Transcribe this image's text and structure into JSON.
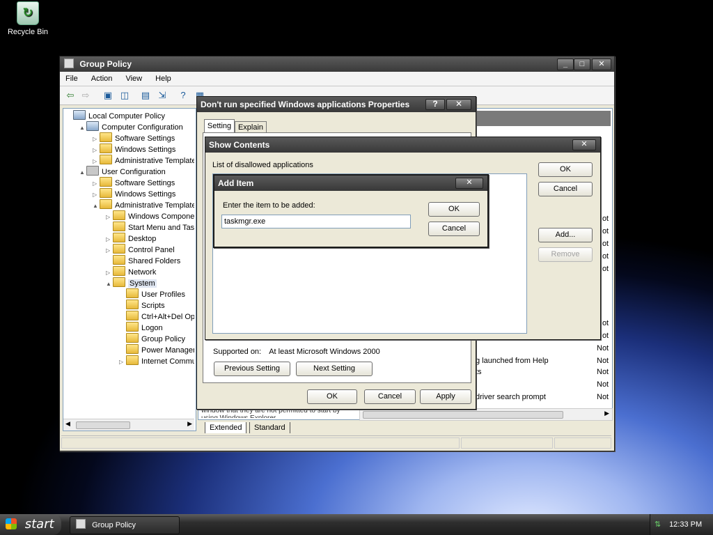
{
  "desktop": {
    "recycle_bin": "Recycle Bin"
  },
  "main_window": {
    "title": "Group Policy",
    "menu": [
      "File",
      "Action",
      "View",
      "Help"
    ],
    "tree": [
      {
        "label": "Local Computer Policy",
        "level": 0,
        "type": "computer"
      },
      {
        "label": "Computer Configuration",
        "level": 1,
        "type": "computer",
        "expander": "▲"
      },
      {
        "label": "Software Settings",
        "level": 2,
        "type": "folder",
        "expander": "▷"
      },
      {
        "label": "Windows Settings",
        "level": 2,
        "type": "folder",
        "expander": "▷"
      },
      {
        "label": "Administrative Templates",
        "level": 2,
        "type": "folder",
        "expander": "▷"
      },
      {
        "label": "User Configuration",
        "level": 1,
        "type": "user",
        "expander": "▲"
      },
      {
        "label": "Software Settings",
        "level": 2,
        "type": "folder",
        "expander": "▷"
      },
      {
        "label": "Windows Settings",
        "level": 2,
        "type": "folder",
        "expander": "▷"
      },
      {
        "label": "Administrative Templates",
        "level": 2,
        "type": "folder",
        "expander": "▲"
      },
      {
        "label": "Windows Components",
        "level": 3,
        "type": "folder",
        "expander": "▷"
      },
      {
        "label": "Start Menu and Taskbar",
        "level": 3,
        "type": "folder",
        "expander": ""
      },
      {
        "label": "Desktop",
        "level": 3,
        "type": "folder",
        "expander": "▷"
      },
      {
        "label": "Control Panel",
        "level": 3,
        "type": "folder",
        "expander": "▷"
      },
      {
        "label": "Shared Folders",
        "level": 3,
        "type": "folder",
        "expander": ""
      },
      {
        "label": "Network",
        "level": 3,
        "type": "folder",
        "expander": "▷"
      },
      {
        "label": "System",
        "level": 3,
        "type": "folder",
        "expander": "▲",
        "selected": true
      },
      {
        "label": "User Profiles",
        "level": 4,
        "type": "folder",
        "expander": ""
      },
      {
        "label": "Scripts",
        "level": 4,
        "type": "folder",
        "expander": ""
      },
      {
        "label": "Ctrl+Alt+Del Options",
        "level": 4,
        "type": "folder",
        "expander": ""
      },
      {
        "label": "Logon",
        "level": 4,
        "type": "folder",
        "expander": ""
      },
      {
        "label": "Group Policy",
        "level": 4,
        "type": "folder",
        "expander": ""
      },
      {
        "label": "Power Management",
        "level": 4,
        "type": "folder",
        "expander": ""
      },
      {
        "label": "Internet Communication",
        "level": 4,
        "type": "folder",
        "expander": "▷"
      }
    ],
    "right_list": [
      {
        "name": "",
        "state": "Not"
      },
      {
        "name": "",
        "state": "Not"
      },
      {
        "name": "",
        "state": "Not"
      },
      {
        "name": "",
        "state": "Not"
      },
      {
        "name": "",
        "state": "Not"
      },
      {
        "name": "",
        "state": "Not"
      },
      {
        "name": "",
        "state": "Not"
      },
      {
        "name": "",
        "state": "Not"
      },
      {
        "name": "g launched from Help",
        "state": "Not"
      },
      {
        "name": "ts",
        "state": "Not"
      },
      {
        "name": "",
        "state": "Not"
      },
      {
        "name": "driver search prompt",
        "state": "Not"
      }
    ],
    "explain_snippet": "window that they are not permitted to start by using Windows Explorer",
    "tabs": [
      "Extended",
      "Standard"
    ]
  },
  "properties_dialog": {
    "title": "Don't run specified Windows applications Properties",
    "tabs": [
      "Setting",
      "Explain"
    ],
    "supported_label": "Supported on:",
    "supported_value": "At least Microsoft Windows 2000",
    "prev_button": "Previous Setting",
    "next_button": "Next Setting",
    "ok": "OK",
    "cancel": "Cancel",
    "apply": "Apply"
  },
  "show_contents_dialog": {
    "title": "Show Contents",
    "list_label": "List of disallowed applications",
    "ok": "OK",
    "cancel": "Cancel",
    "add": "Add...",
    "remove": "Remove"
  },
  "add_item_dialog": {
    "title": "Add Item",
    "prompt": "Enter the item to be added:",
    "value": "taskmgr.exe",
    "ok": "OK",
    "cancel": "Cancel"
  },
  "taskbar": {
    "start": "start",
    "task": "Group Policy",
    "clock": "12:33 PM"
  }
}
